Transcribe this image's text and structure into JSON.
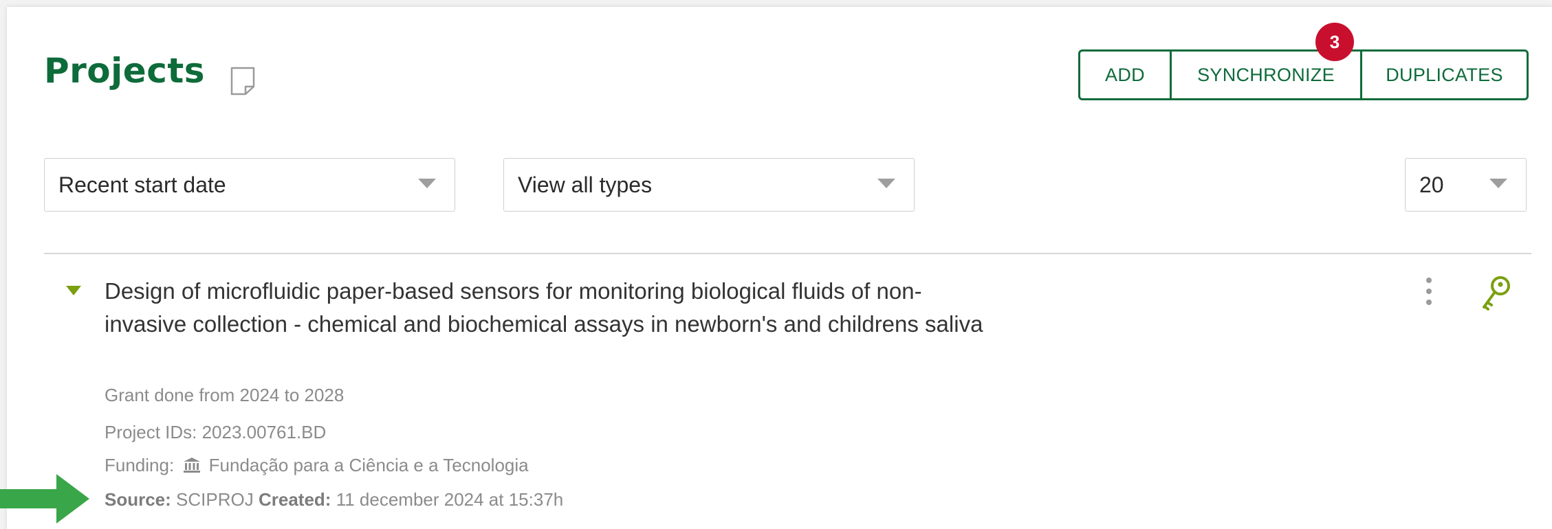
{
  "page": {
    "title": "Projects"
  },
  "toolbar": {
    "add_label": "ADD",
    "sync_label": "SYNCHRONIZE",
    "sync_badge": "3",
    "duplicates_label": "DUPLICATES"
  },
  "filters": {
    "sort_value": "Recent start date",
    "type_value": "View all types",
    "per_page_value": "20"
  },
  "project": {
    "title": "Design of microfluidic paper-based sensors for monitoring biological fluids of non-invasive collection - chemical and biochemical assays in newborn's and childrens saliva",
    "grant": "Grant done from 2024 to 2028",
    "ids": "Project IDs: 2023.00761.BD",
    "funding_label": "Funding:",
    "funding_value": "Fundação para a Ciência e a Tecnologia",
    "source_label": "Source:",
    "source_value": "SCIPROJ",
    "created_label": "Created:",
    "created_value": "11 december 2024 at 15:37h"
  },
  "colors": {
    "brand_green": "#0e6b3a",
    "accent_lime": "#7aa00e",
    "badge_red": "#c8102e",
    "annotation_arrow": "#3aa64a"
  },
  "icons": {
    "title_note": "note-icon",
    "expand": "caret-down-icon",
    "menu": "kebab-menu-icon",
    "access": "key-icon",
    "funding": "institution-icon",
    "annotation": "arrow-right-icon"
  }
}
